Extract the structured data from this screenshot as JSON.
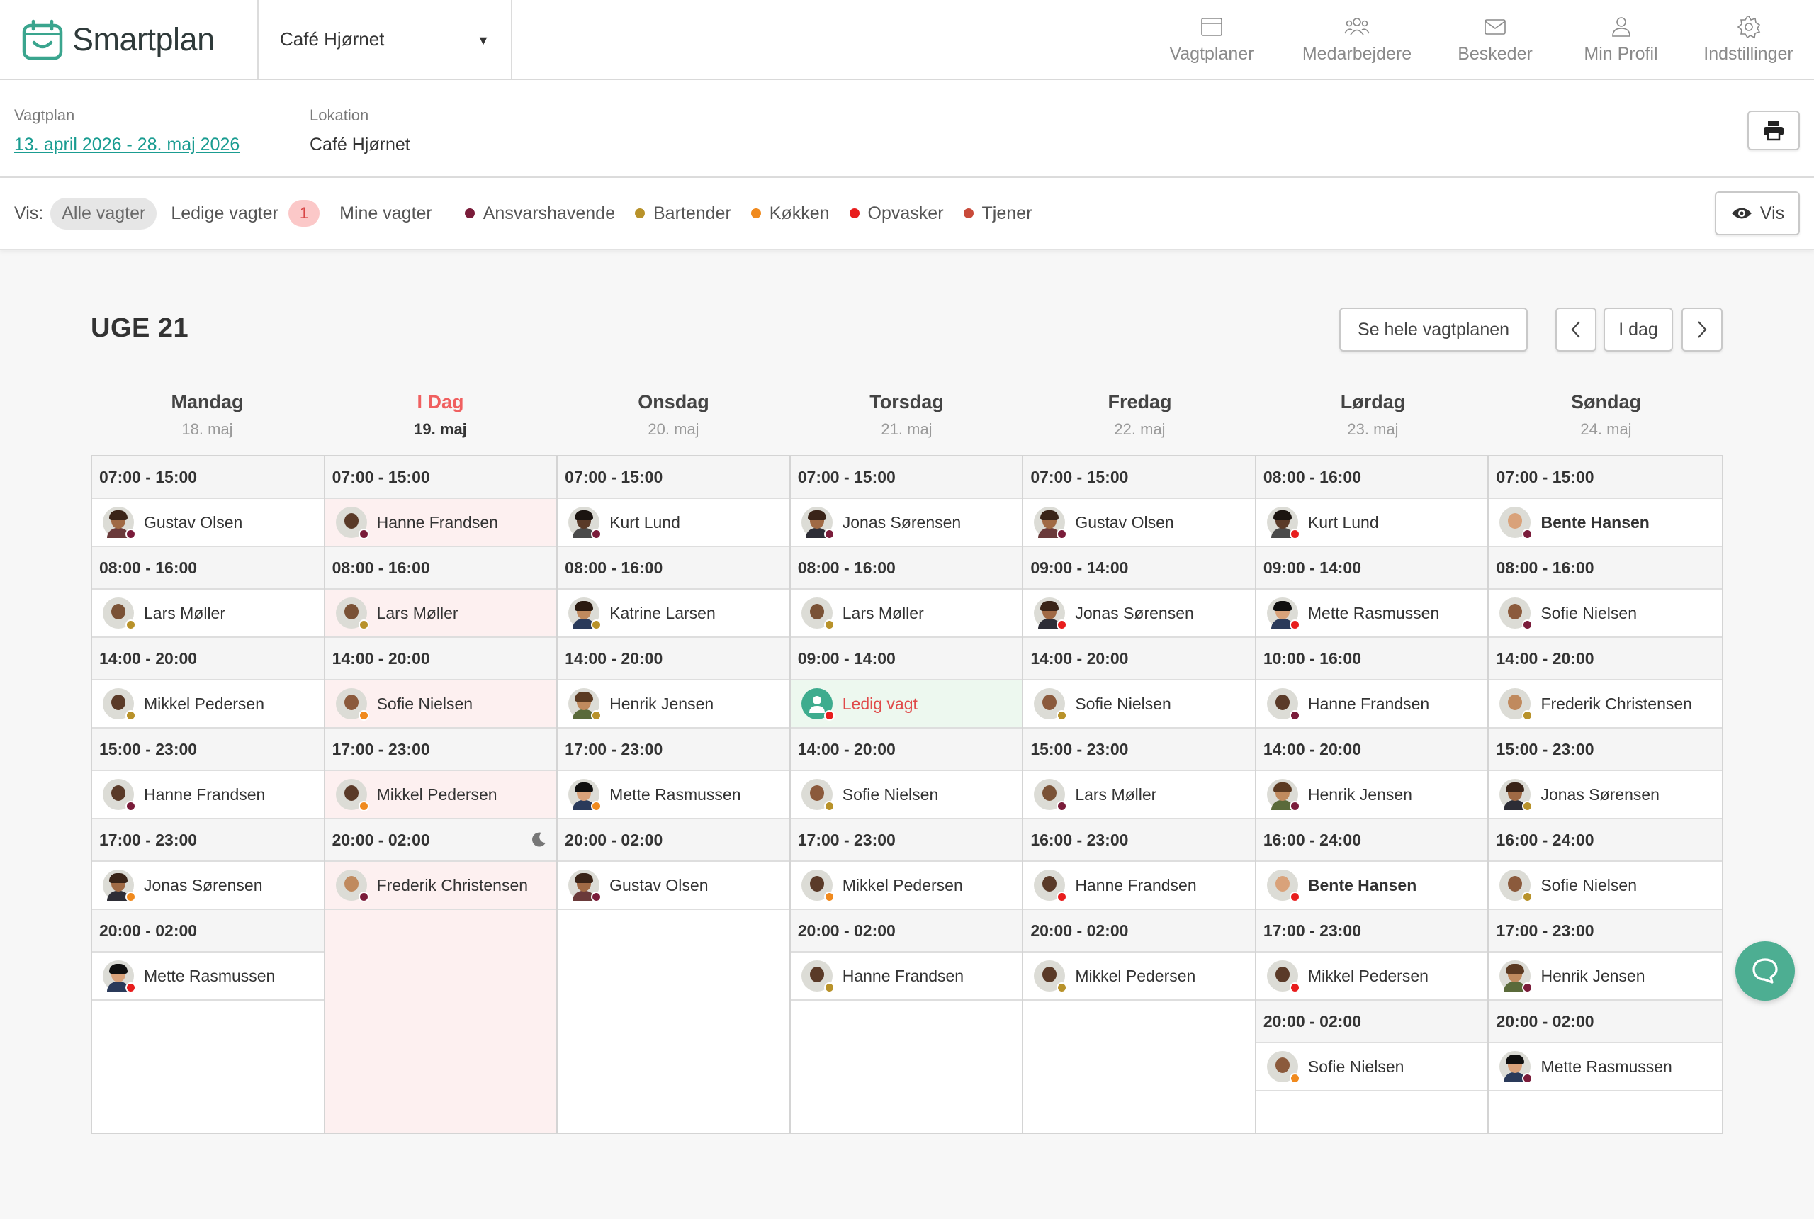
{
  "app": {
    "name": "Smartplan",
    "location_selector": "Café Hjørnet"
  },
  "nav": [
    {
      "label": "Vagtplaner",
      "icon": "calendar-card-icon"
    },
    {
      "label": "Medarbejdere",
      "icon": "users-icon"
    },
    {
      "label": "Beskeder",
      "icon": "mail-icon"
    },
    {
      "label": "Min Profil",
      "icon": "user-icon"
    },
    {
      "label": "Indstillinger",
      "icon": "gear-icon"
    }
  ],
  "info": {
    "plan_label": "Vagtplan",
    "plan_value": "13. april 2026 - 28. maj 2026",
    "location_label": "Lokation",
    "location_value": "Café Hjørnet"
  },
  "filters": {
    "vis_label": "Vis:",
    "all": "Alle vagter",
    "free": "Ledige vagter",
    "free_count": "1",
    "mine": "Mine vagter",
    "vis_button": "Vis"
  },
  "roles": [
    {
      "name": "Ansvarshavende",
      "color": "#7a1c3a"
    },
    {
      "name": "Bartender",
      "color": "#b8922a"
    },
    {
      "name": "Køkken",
      "color": "#f08a1e"
    },
    {
      "name": "Opvasker",
      "color": "#e81d1d"
    },
    {
      "name": "Tjener",
      "color": "#c94a3a"
    }
  ],
  "week": {
    "title": "UGE 21",
    "see_all": "Se hele vagtplanen",
    "today_button": "I dag"
  },
  "days": [
    {
      "name": "Mandag",
      "date": "18. maj",
      "today": false,
      "shifts": [
        {
          "time": "07:00 - 15:00",
          "employee": "Gustav Olsen",
          "role": 0
        },
        {
          "time": "08:00 - 16:00",
          "employee": "Lars Møller",
          "role": 1
        },
        {
          "time": "14:00 - 20:00",
          "employee": "Mikkel Pedersen",
          "role": 1
        },
        {
          "time": "15:00 - 23:00",
          "employee": "Hanne Frandsen",
          "role": 0
        },
        {
          "time": "17:00 - 23:00",
          "employee": "Jonas Sørensen",
          "role": 2
        },
        {
          "time": "20:00 - 02:00",
          "employee": "Mette Rasmussen",
          "role": 3
        }
      ]
    },
    {
      "name": "I Dag",
      "date": "19. maj",
      "today": true,
      "shifts": [
        {
          "time": "07:00 - 15:00",
          "employee": "Hanne Frandsen",
          "role": 0
        },
        {
          "time": "08:00 - 16:00",
          "employee": "Lars Møller",
          "role": 1
        },
        {
          "time": "14:00 - 20:00",
          "employee": "Sofie Nielsen",
          "role": 2
        },
        {
          "time": "17:00 - 23:00",
          "employee": "Mikkel Pedersen",
          "role": 2
        },
        {
          "time": "20:00 - 02:00",
          "employee": "Frederik Christensen",
          "role": 0,
          "night": true
        }
      ]
    },
    {
      "name": "Onsdag",
      "date": "20. maj",
      "today": false,
      "shifts": [
        {
          "time": "07:00 - 15:00",
          "employee": "Kurt Lund",
          "role": 0
        },
        {
          "time": "08:00 - 16:00",
          "employee": "Katrine Larsen",
          "role": 1
        },
        {
          "time": "14:00 - 20:00",
          "employee": "Henrik Jensen",
          "role": 1
        },
        {
          "time": "17:00 - 23:00",
          "employee": "Mette Rasmussen",
          "role": 2
        },
        {
          "time": "20:00 - 02:00",
          "employee": "Gustav Olsen",
          "role": 0
        }
      ]
    },
    {
      "name": "Torsdag",
      "date": "21. maj",
      "today": false,
      "shifts": [
        {
          "time": "07:00 - 15:00",
          "employee": "Jonas Sørensen",
          "role": 0
        },
        {
          "time": "08:00 - 16:00",
          "employee": "Lars Møller",
          "role": 1
        },
        {
          "time": "09:00 - 14:00",
          "employee": "Ledig vagt",
          "role": 3,
          "free": true
        },
        {
          "time": "14:00 - 20:00",
          "employee": "Sofie Nielsen",
          "role": 1
        },
        {
          "time": "17:00 - 23:00",
          "employee": "Mikkel Pedersen",
          "role": 2
        },
        {
          "time": "20:00 - 02:00",
          "employee": "Hanne Frandsen",
          "role": 1
        }
      ]
    },
    {
      "name": "Fredag",
      "date": "22. maj",
      "today": false,
      "shifts": [
        {
          "time": "07:00 - 15:00",
          "employee": "Gustav Olsen",
          "role": 0
        },
        {
          "time": "09:00 - 14:00",
          "employee": "Jonas Sørensen",
          "role": 3
        },
        {
          "time": "14:00 - 20:00",
          "employee": "Sofie Nielsen",
          "role": 1
        },
        {
          "time": "15:00 - 23:00",
          "employee": "Lars Møller",
          "role": 0
        },
        {
          "time": "16:00 - 23:00",
          "employee": "Hanne Frandsen",
          "role": 3
        },
        {
          "time": "20:00 - 02:00",
          "employee": "Mikkel Pedersen",
          "role": 1
        }
      ]
    },
    {
      "name": "Lørdag",
      "date": "23. maj",
      "today": false,
      "shifts": [
        {
          "time": "08:00 - 16:00",
          "employee": "Kurt Lund",
          "role": 3
        },
        {
          "time": "09:00 - 14:00",
          "employee": "Mette Rasmussen",
          "role": 3
        },
        {
          "time": "10:00 - 16:00",
          "employee": "Hanne Frandsen",
          "role": 0
        },
        {
          "time": "14:00 - 20:00",
          "employee": "Henrik Jensen",
          "role": 0
        },
        {
          "time": "16:00 - 24:00",
          "employee": "Bente Hansen",
          "role": 3,
          "bold": true
        },
        {
          "time": "17:00 - 23:00",
          "employee": "Mikkel Pedersen",
          "role": 3
        },
        {
          "time": "20:00 - 02:00",
          "employee": "Sofie Nielsen",
          "role": 2
        }
      ]
    },
    {
      "name": "Søndag",
      "date": "24. maj",
      "today": false,
      "shifts": [
        {
          "time": "07:00 - 15:00",
          "employee": "Bente Hansen",
          "role": 0,
          "bold": true
        },
        {
          "time": "08:00 - 16:00",
          "employee": "Sofie Nielsen",
          "role": 0
        },
        {
          "time": "14:00 - 20:00",
          "employee": "Frederik Christensen",
          "role": 1
        },
        {
          "time": "15:00 - 23:00",
          "employee": "Jonas Sørensen",
          "role": 1
        },
        {
          "time": "16:00 - 24:00",
          "employee": "Sofie Nielsen",
          "role": 1
        },
        {
          "time": "17:00 - 23:00",
          "employee": "Henrik Jensen",
          "role": 0
        },
        {
          "time": "20:00 - 02:00",
          "employee": "Mette Rasmussen",
          "role": 0
        }
      ]
    }
  ]
}
